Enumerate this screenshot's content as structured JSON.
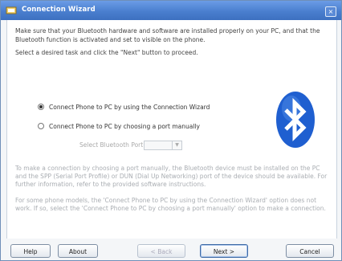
{
  "window": {
    "title": "Connection Wizard",
    "close_glyph": "×"
  },
  "content": {
    "intro": "Make sure that your Bluetooth hardware and software are installed properly on your PC, and that the Bluetooth function is activated and set to visible on the phone.",
    "instruction": "Select a desired task and click the \"Next\" button to proceed.",
    "options": [
      {
        "label": "Connect Phone to PC by using the Connection Wizard",
        "selected": true
      },
      {
        "label": "Connect Phone to PC by choosing a port manually",
        "selected": false
      }
    ],
    "port": {
      "label": "Select Bluetooth Port:",
      "value": ""
    },
    "note1": "To make a connection by choosing a port manually, the Bluetooth device must be installed on the PC and the SPP (Serial Port Profile) or DUN (Dial Up Networking) port of the device should be available. For further information, refer to the provided software instructions.",
    "note2": "For some phone models, the 'Connect Phone to PC by using the Connection Wizard' option does not work. If so, select the 'Connect Phone to PC by choosing a port manually' option to make a connection."
  },
  "buttons": {
    "help": "Help",
    "about": "About",
    "back": "< Back",
    "next": "Next >",
    "cancel": "Cancel"
  },
  "colors": {
    "titlebar": "#4a7fcf",
    "bluetooth": "#1f5fd0"
  },
  "icons": {
    "app": "wizard-icon",
    "logo": "bluetooth-icon"
  }
}
